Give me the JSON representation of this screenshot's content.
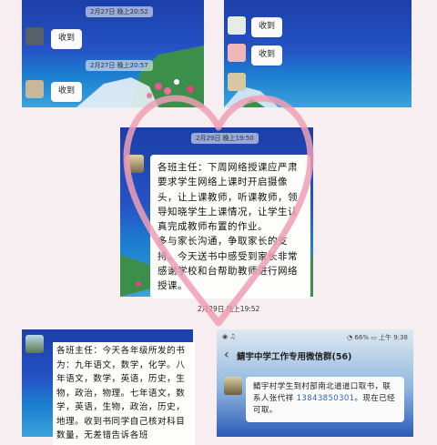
{
  "panels": {
    "top_left": {
      "timestamps": [
        "2月27日 晚上20:52",
        "2月27日 晚上20:57"
      ],
      "messages": [
        "收到",
        "收到"
      ]
    },
    "top_right": {
      "messages": [
        "收到",
        "收到"
      ]
    },
    "center": {
      "timestamp_top": "2月29日 晚上19:50",
      "message": "各班主任：下周网络授课应严肃要求学生网络上课时开启摄像头，让上课教师，听课教师，领导知晓学生上课情况，让学生认真完成教师布置的作业。\n多与家长沟通，争取家长的支持。今天送书中感受到家长非常感谢学校和台帮助教师进行网络授课。",
      "timestamp_bottom": "2月29日 晚上19:52"
    },
    "bottom_left": {
      "message": "各班主任：今天各年级所发的书为：九年语文，数学，化学。八年语文，数学，英语，历史，生物，政治，物理。七年语文，数学，英语，生物，政治，历史，地理。收到书同学自己核对科目数量，无差错告诉各班"
    },
    "bottom_right": {
      "status_left": "◉ ♫",
      "status_right": "◔ 66% ▭ 上午 9:38",
      "chat_title": "鲭宇中学工作专用微信群(56)",
      "message": "鲭宇村学生到村部南北道道口取书，联系人张代祥 13843850301。现在已经可取。",
      "phone": "13843850301"
    }
  },
  "colors": {
    "heart": "#ef9fb4",
    "link": "#2f63c8",
    "sea": "#2452c4"
  }
}
